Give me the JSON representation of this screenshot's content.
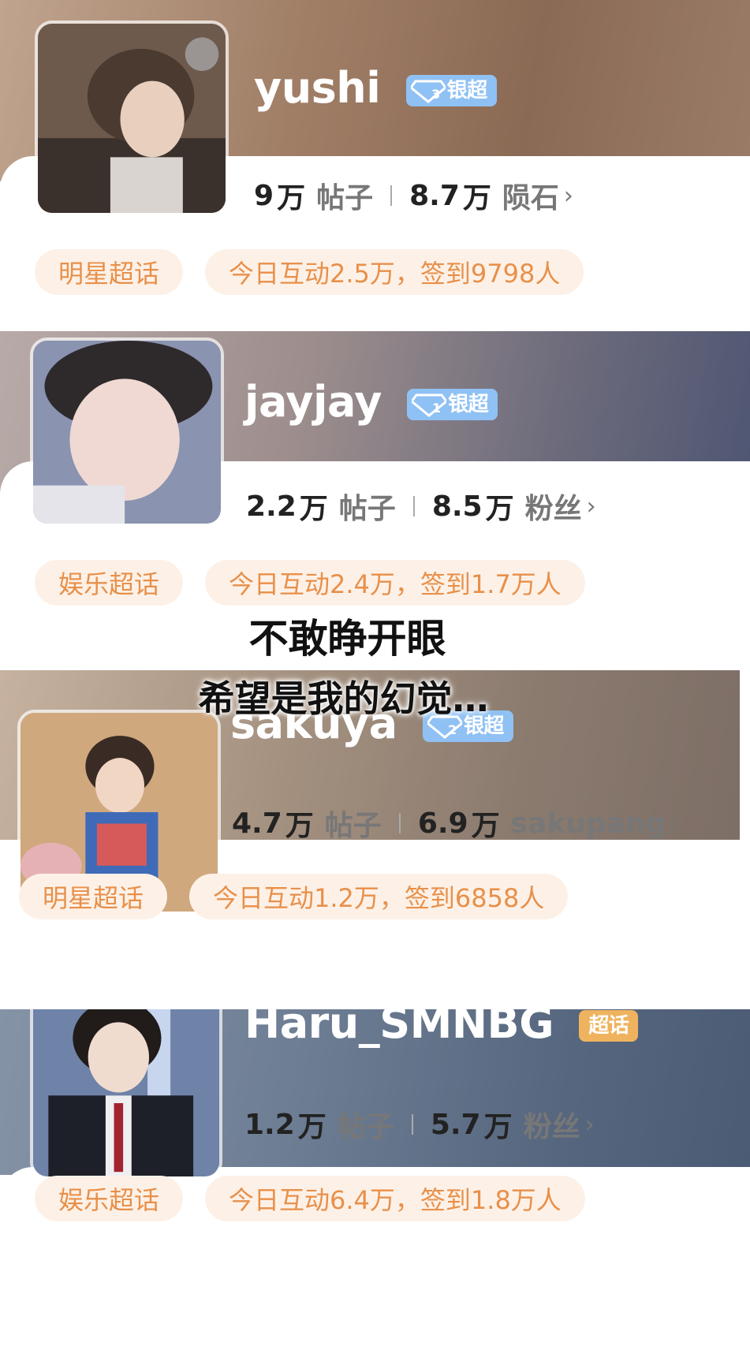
{
  "cards": [
    {
      "name": "yushi",
      "badge": {
        "label": "银超",
        "level": "3",
        "type": "silver"
      },
      "posts_value": "9",
      "posts_unit": "万",
      "posts_label": "帖子",
      "second_value": "8.7",
      "second_unit": "万",
      "second_label": "陨石",
      "chevron": "›",
      "tag1": "明星超话",
      "tag2": "今日互动2.5万，签到9798人"
    },
    {
      "name": "jayjay",
      "badge": {
        "label": "银超",
        "level": "1",
        "type": "silver"
      },
      "posts_value": "2.2",
      "posts_unit": "万",
      "posts_label": "帖子",
      "second_value": "8.5",
      "second_unit": "万",
      "second_label": "粉丝",
      "chevron": "›",
      "tag1": "娱乐超话",
      "tag2": "今日互动2.4万，签到1.7万人"
    },
    {
      "name": "sakuya",
      "badge": {
        "label": "银超",
        "level": "2",
        "type": "silver"
      },
      "posts_value": "4.7",
      "posts_unit": "万",
      "posts_label": "帖子",
      "second_value": "6.9",
      "second_unit": "万",
      "second_label": "sakupang",
      "chevron": "›",
      "tag1": "明星超话",
      "tag2": "今日互动1.2万，签到6858人"
    },
    {
      "name": "Haru_SMNBG",
      "badge": {
        "label": "超话",
        "type": "gold"
      },
      "posts_value": "1.2",
      "posts_unit": "万",
      "posts_label": "帖子",
      "second_value": "5.7",
      "second_unit": "万",
      "second_label": "粉丝",
      "chevron": "›",
      "tag1": "娱乐超话",
      "tag2": "今日互动6.4万，签到1.8万人"
    }
  ],
  "overlay": {
    "line1": "不敢睁开眼",
    "line2": "希望是我的幻觉…"
  },
  "colors": {
    "tag_bg": "#fdf1e7",
    "tag_text": "#e8904a",
    "silver_badge": "#8fc1f4",
    "gold_badge": "#efb35f"
  }
}
